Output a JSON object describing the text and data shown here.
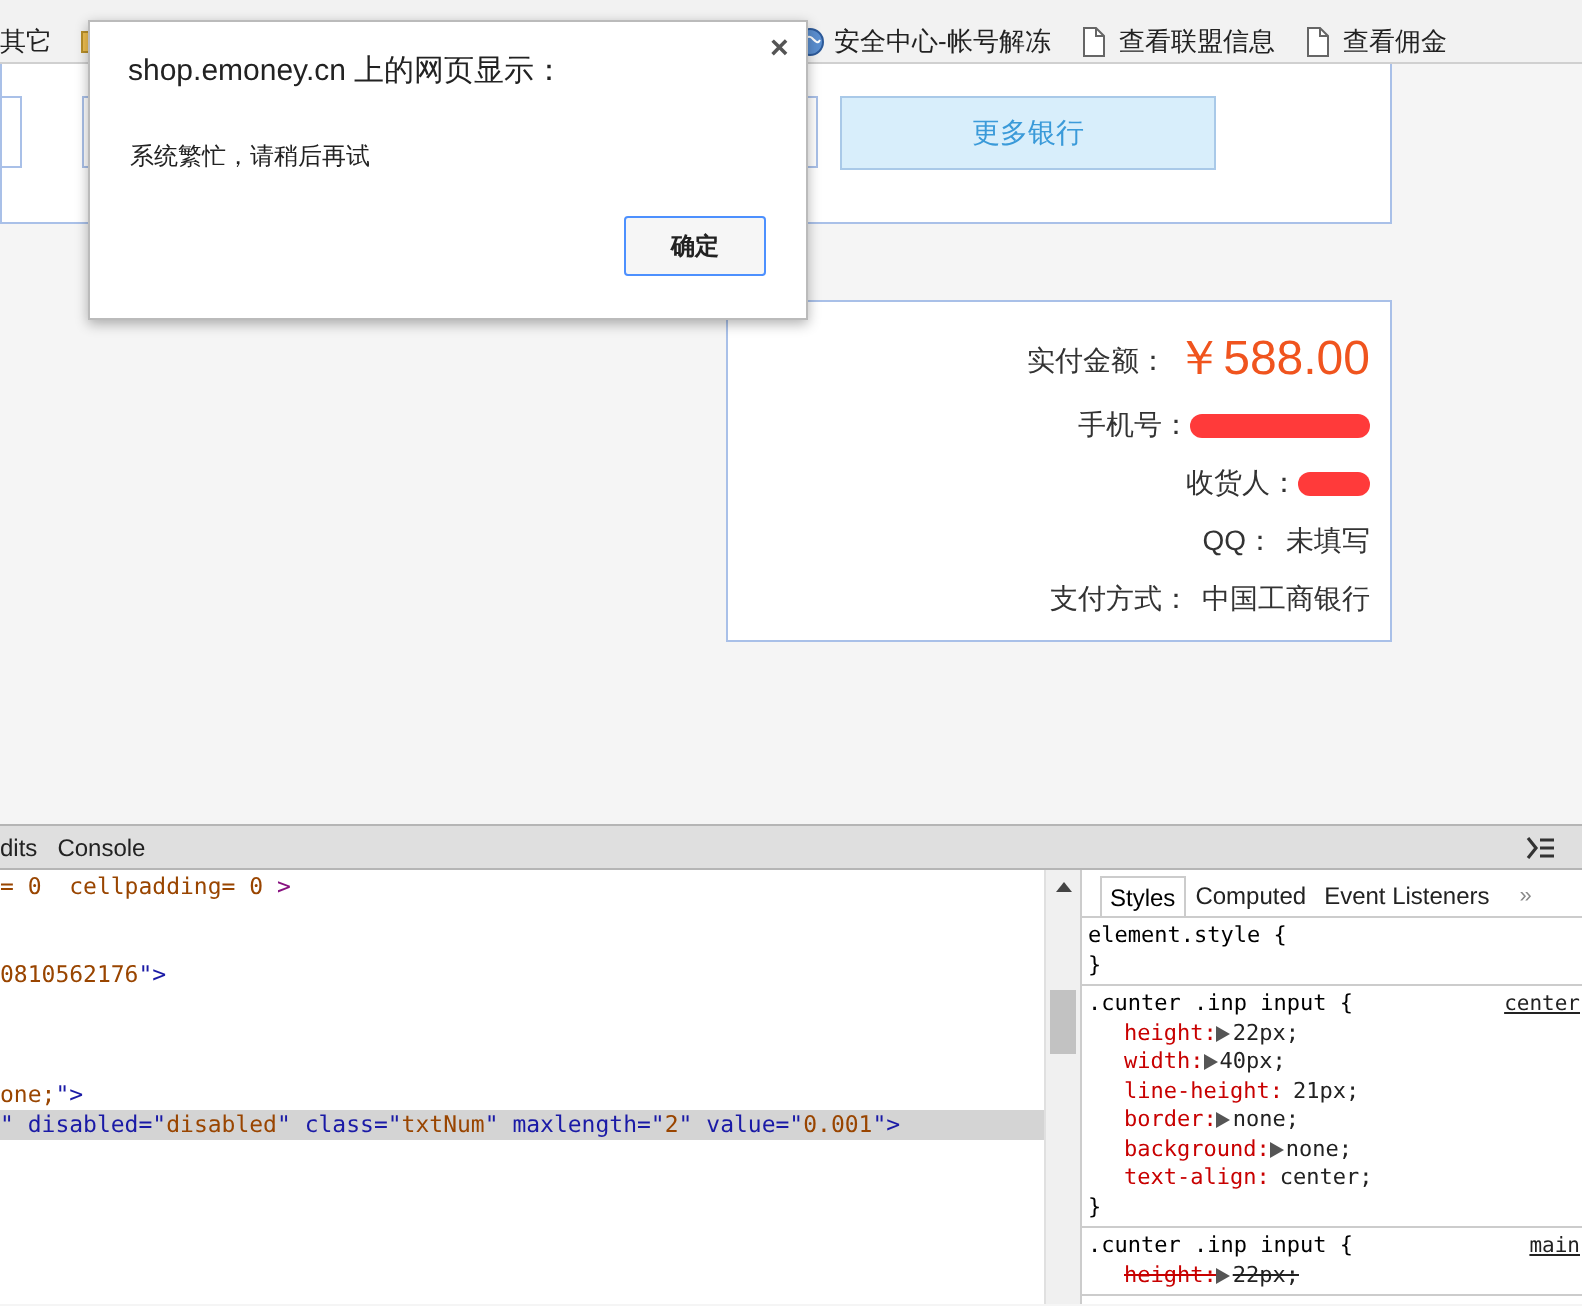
{
  "bookmarks": [
    {
      "label": "其它"
    },
    {
      "label": "安全中心-帐号解冻"
    },
    {
      "label": "查看联盟信息"
    },
    {
      "label": "查看佣金"
    }
  ],
  "banks": {
    "more_button": "更多银行"
  },
  "summary": {
    "rows": [
      {
        "label": "实付金额：",
        "value": "￥588.00",
        "kind": "amount"
      },
      {
        "label": "手机号：",
        "kind": "redacted"
      },
      {
        "label": "收货人：",
        "kind": "redacted"
      },
      {
        "label": "QQ：",
        "value": "未填写",
        "kind": "text"
      },
      {
        "label": "支付方式：",
        "value": "中国工商银行",
        "kind": "text"
      }
    ]
  },
  "dialog": {
    "title": "shop.emoney.cn 上的网页显示：",
    "close": "×",
    "message": "系统繁忙，请稍后再试",
    "ok_button": "确定"
  },
  "devtools": {
    "tabs": [
      {
        "label": "dits",
        "selected": false
      },
      {
        "label": "Console",
        "selected": false
      }
    ],
    "code_lines": [
      {
        "text": "= 0  cellpadding= 0 >",
        "selected": false
      },
      {
        "text": "0810562176\">",
        "selected": false
      },
      {
        "text": "one;\">",
        "selected": false
      },
      {
        "text": "\" disabled=\"disabled\" class=\"txtNum\" maxlength=\"2\" value=\"0.001\">",
        "selected": true
      }
    ],
    "style_tabs": [
      {
        "label": "Styles",
        "selected": true
      },
      {
        "label": "Computed",
        "selected": false
      },
      {
        "label": "Event Listeners",
        "selected": false
      }
    ],
    "more": "»",
    "rules": [
      {
        "selector": "element.style {",
        "close": "}"
      },
      {
        "selector": ".cunter .inp input {",
        "source": "center",
        "close": "}",
        "props": [
          {
            "name": "height:",
            "value": "22px;",
            "arrow": true,
            "struck": false
          },
          {
            "name": "width:",
            "value": "40px;",
            "arrow": true,
            "struck": false
          },
          {
            "name": "line-height:",
            "value": "21px;",
            "arrow": false,
            "struck": false
          },
          {
            "name": "border:",
            "value": "none;",
            "arrow": true,
            "struck": false
          },
          {
            "name": "background:",
            "value": "none;",
            "arrow": true,
            "struck": false
          },
          {
            "name": "text-align:",
            "value": "center;",
            "arrow": false,
            "struck": false
          }
        ]
      },
      {
        "selector": ".cunter .inp input {",
        "source": "main",
        "props": [
          {
            "name": "height:",
            "value": "22px;",
            "arrow": true,
            "struck": true
          }
        ]
      }
    ]
  }
}
